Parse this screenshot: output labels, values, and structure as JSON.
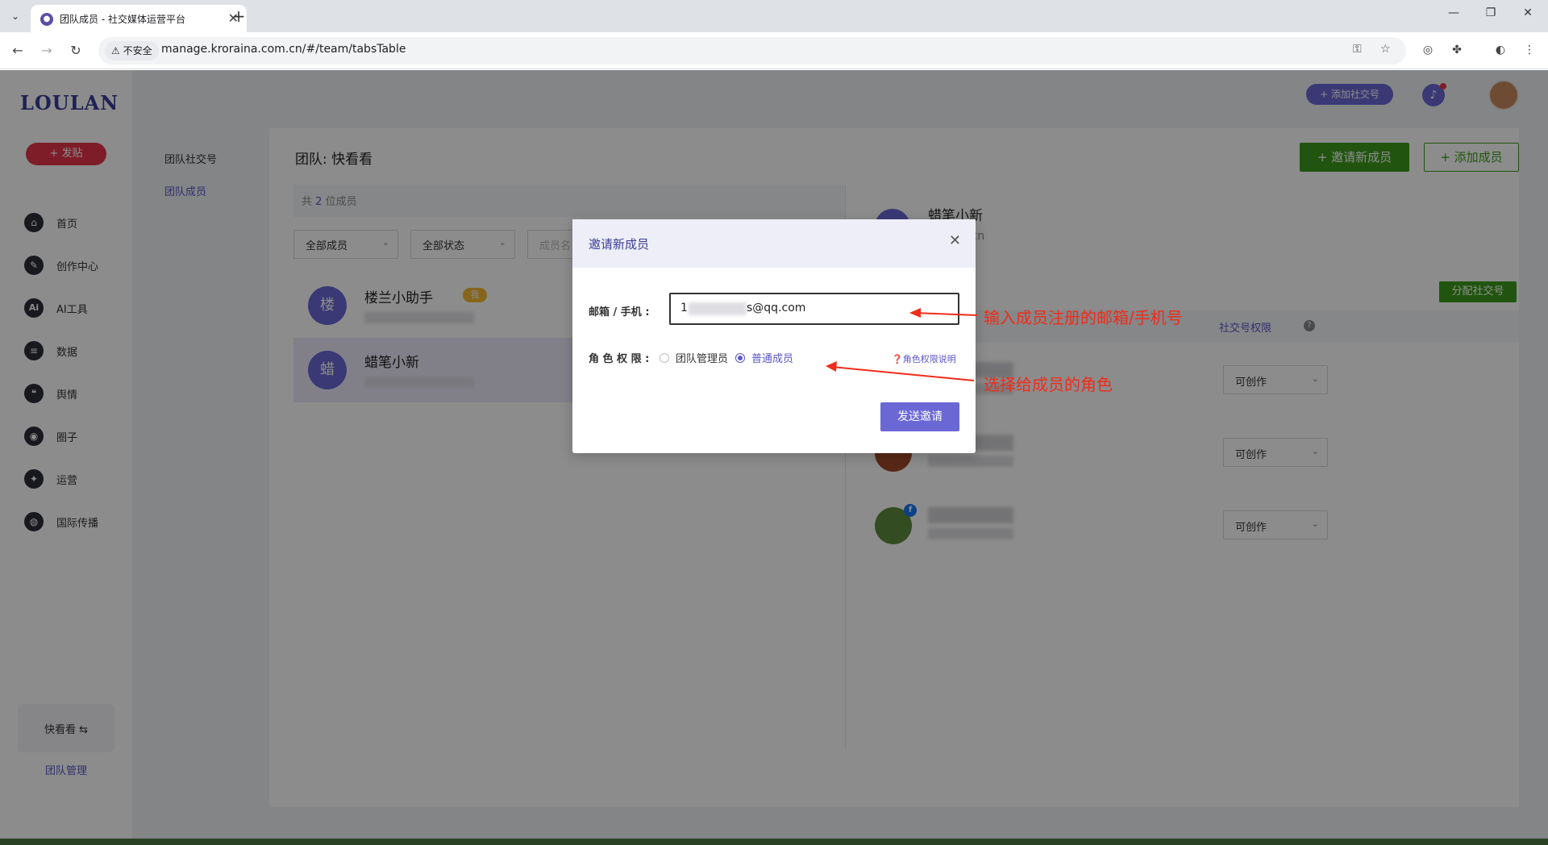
{
  "browser": {
    "tab_title": "团队成员 - 社交媒体运营平台",
    "tab_list_glyph": "⌄",
    "tab_close_glyph": "✕",
    "new_tab_glyph": "+",
    "minimize_glyph": "—",
    "restore_glyph": "❐",
    "close_glyph": "✕",
    "insecure_label": "不安全",
    "url": "manage.kroraina.com.cn/#/team/tabsTable"
  },
  "sidebar": {
    "logo": "LOULAN",
    "post_button": "+ 发贴",
    "items": [
      {
        "label": "首页",
        "icon": "home-icon",
        "glyph": "⌂"
      },
      {
        "label": "创作中心",
        "icon": "palette-icon",
        "glyph": "✎"
      },
      {
        "label": "AI工具",
        "icon": "ai-icon",
        "glyph": "Ai"
      },
      {
        "label": "数据",
        "icon": "database-icon",
        "glyph": "≡"
      },
      {
        "label": "舆情",
        "icon": "quote-icon",
        "glyph": "❝"
      },
      {
        "label": "圈子",
        "icon": "compass-icon",
        "glyph": "◉"
      },
      {
        "label": "运营",
        "icon": "shield-icon",
        "glyph": "✦"
      },
      {
        "label": "国际传播",
        "icon": "globe-icon",
        "glyph": "◍"
      }
    ],
    "team_switch": "快看看 ⇆",
    "team_manage": "团队管理"
  },
  "subnav": {
    "items": [
      {
        "label": "团队社交号"
      },
      {
        "label": "团队成员"
      }
    ]
  },
  "topbar": {
    "add_account": "+ 添加社交号",
    "bell_glyph": "🔔"
  },
  "team": {
    "title": "团队: 快看看",
    "invite_button": "+ 邀请新成员",
    "add_member_button": "+ 添加成员",
    "count_prefix": "共",
    "count": "2",
    "count_suffix": "位成员",
    "filters": [
      "全部成员",
      "全部状态",
      "成员名"
    ],
    "members": [
      {
        "avatar": "楼",
        "name": "楼兰小助手",
        "badge": "我"
      },
      {
        "avatar": "蜡",
        "name": "蜡笔小新"
      }
    ]
  },
  "detail": {
    "name": "蜡笔小新",
    "email": "un@cri.cn",
    "assign_button": "分配社交号",
    "perm_label": "社交号权限",
    "perm_help": "?",
    "accounts": [
      {
        "permission": "可创作"
      },
      {
        "permission": "可创作"
      },
      {
        "permission": "可创作"
      }
    ]
  },
  "modal": {
    "title": "邀请新成员",
    "close_glyph": "✕",
    "email_label": "邮箱 / 手机 :",
    "email_value_start": "1",
    "email_value_end": "s@qq.com",
    "role_label": "角 色 权 限 :",
    "role_admin": "团队管理员",
    "role_member": "普通成员",
    "role_help": "❓角色权限说明",
    "send_button": "发送邀请"
  },
  "annotations": {
    "email_note": "输入成员注册的邮箱/手机号",
    "role_note": "选择给成员的角色"
  },
  "colors": {
    "accent": "#6b68d6",
    "green": "#3d9b1c",
    "annotation": "#f02c1a"
  }
}
